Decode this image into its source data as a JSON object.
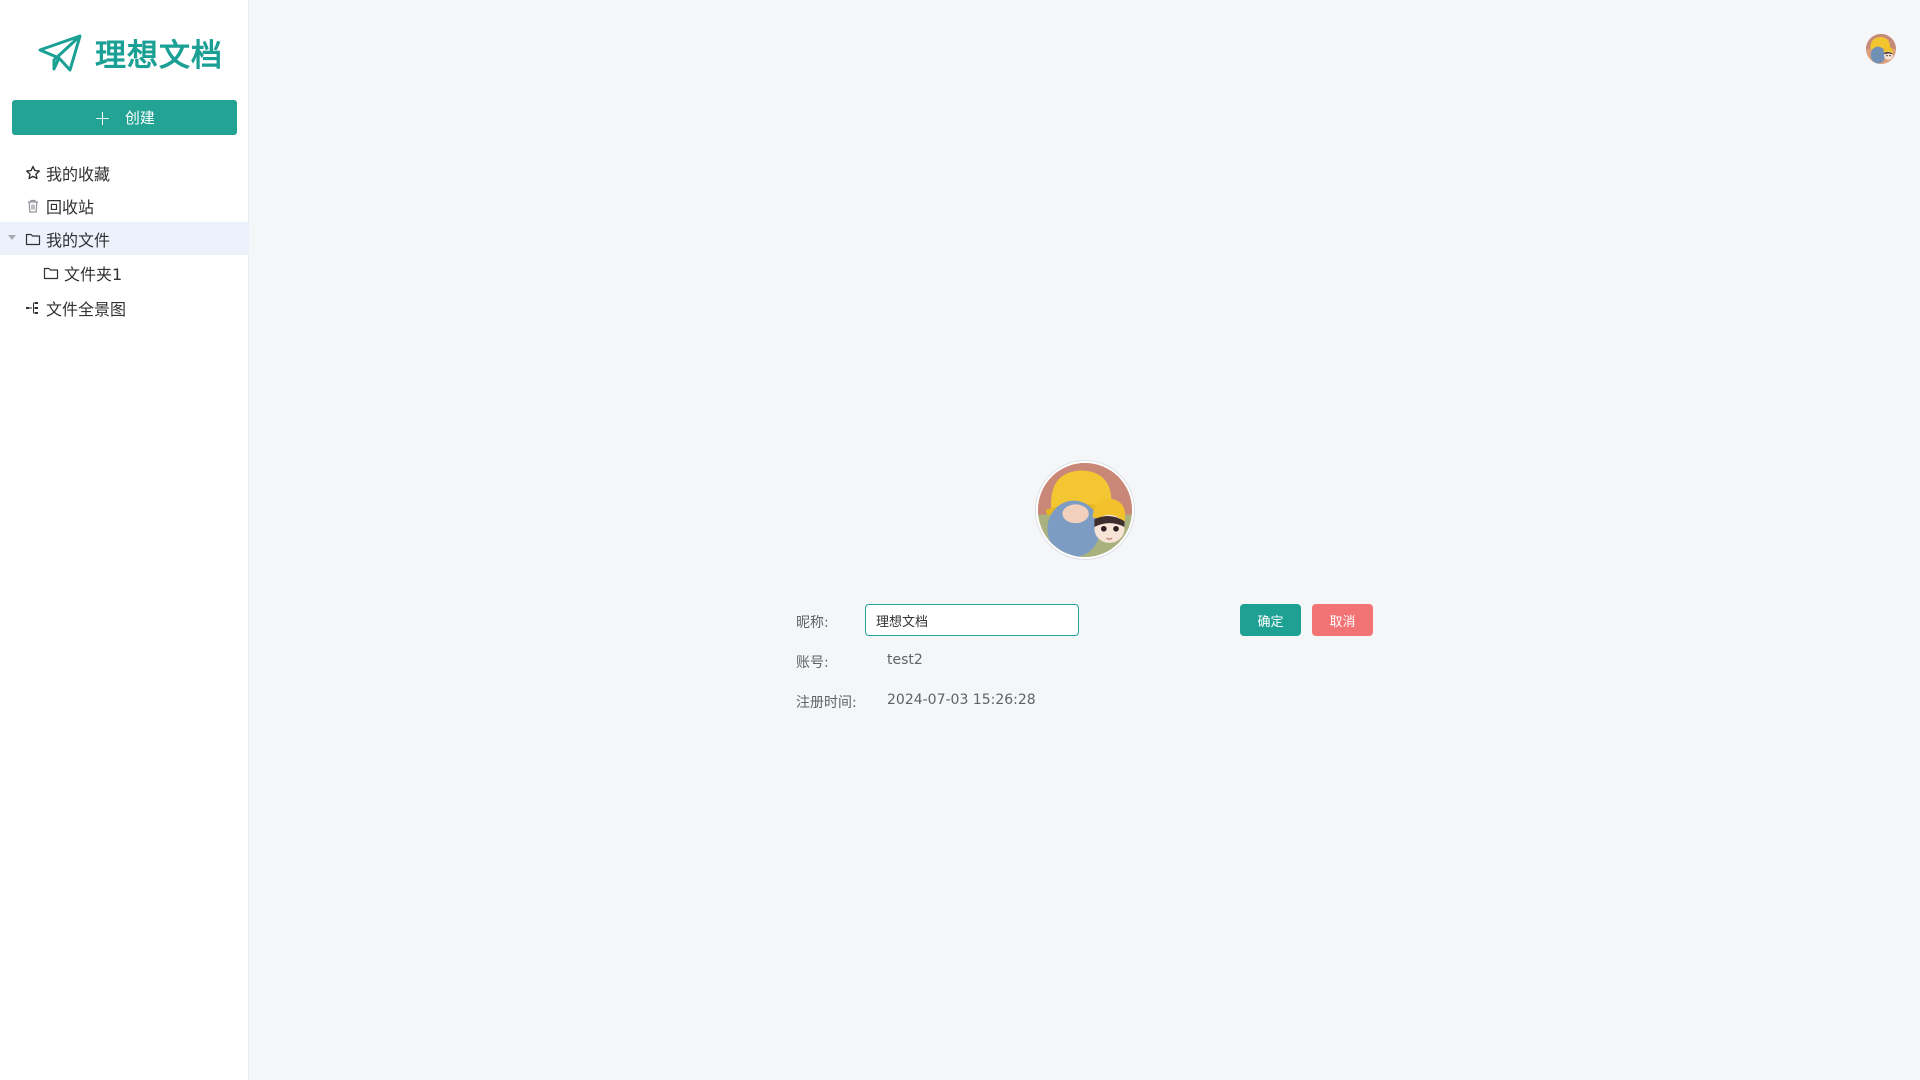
{
  "app": {
    "name": "理想文档",
    "brand_color": "#1aa094"
  },
  "sidebar": {
    "create_label": "创建",
    "items": [
      {
        "label": "我的收藏",
        "icon": "star-icon"
      },
      {
        "label": "回收站",
        "icon": "trash-icon"
      },
      {
        "label": "我的文件",
        "icon": "folder-icon",
        "expanded": true,
        "active": true
      },
      {
        "label": "文件夹1",
        "icon": "folder-icon"
      },
      {
        "label": "文件全景图",
        "icon": "tree-icon"
      }
    ]
  },
  "profile": {
    "nickname_label": "昵称:",
    "nickname_value": "理想文档",
    "account_label": "账号:",
    "account_value": "test2",
    "register_label": "注册时间:",
    "register_value": "2024-07-03 15:26:28",
    "confirm_label": "确定",
    "cancel_label": "取消",
    "confirm_color": "#1ea193",
    "cancel_color": "#f17373"
  }
}
